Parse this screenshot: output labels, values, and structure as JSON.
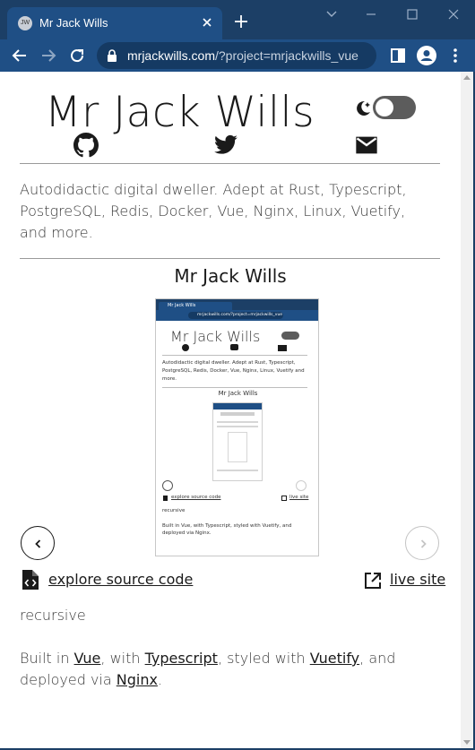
{
  "browser": {
    "tab_title": "Mr Jack Wills",
    "tab_favicon_text": "JW",
    "url_host": "mrjackwills.com",
    "url_path": "/?project=mrjackwills_vue",
    "icons": [
      "back-arrow-icon",
      "forward-arrow-icon",
      "reload-icon",
      "lock-icon",
      "side-panel-icon",
      "profile-icon",
      "kebab-menu-icon",
      "close-icon",
      "plus-icon",
      "chevron-down-icon",
      "minimize-icon",
      "maximize-icon"
    ]
  },
  "header": {
    "title": "Mr Jack Wills",
    "theme_toggle_on": false,
    "social_icons": [
      "github-icon",
      "twitter-icon",
      "email-icon"
    ]
  },
  "bio": "Autodidactic digital dweller. Adept at Rust, Typescript, PostgreSQL, Redis, Docker, Vue, Nginx, Linux, Vuetify, and more.",
  "project": {
    "name": "Mr Jack Wills",
    "source_label": "explore source code",
    "live_label": "live site",
    "description": "recursive",
    "built_parts": {
      "prefix": "Built in ",
      "tech1": "Vue",
      "sep1": ", with ",
      "tech2": "Typescript",
      "sep2": ", styled with ",
      "tech3": "Vuetify",
      "sep3": ", and deployed via ",
      "tech4": "Nginx",
      "suffix": "."
    }
  },
  "preview": {
    "tab_title": "Mr Jack Wills",
    "url": "mrjackwills.com/?project=mrjackwills_vue",
    "title": "Mr Jack Wills",
    "bio": "Autodidactic digital dweller. Adept at Rust, Typescript, PostgreSQL, Redis, Docker, Vue, Nginx, Linux, Vuetify and more.",
    "project_name": "Mr Jack Wills",
    "source_label": "explore source code",
    "live_label": "live site",
    "description": "recursive",
    "built_line1": "Built in Vue, with Typescript, styled with Vuetify, and",
    "built_line2": "deployed via Nginx."
  },
  "colors": {
    "chrome_dark": "#1c3f66",
    "chrome_toolbar": "#1f4f85",
    "omnibox": "#153a63",
    "page_bg": "#ffffff",
    "text": "#1a1a1a"
  }
}
